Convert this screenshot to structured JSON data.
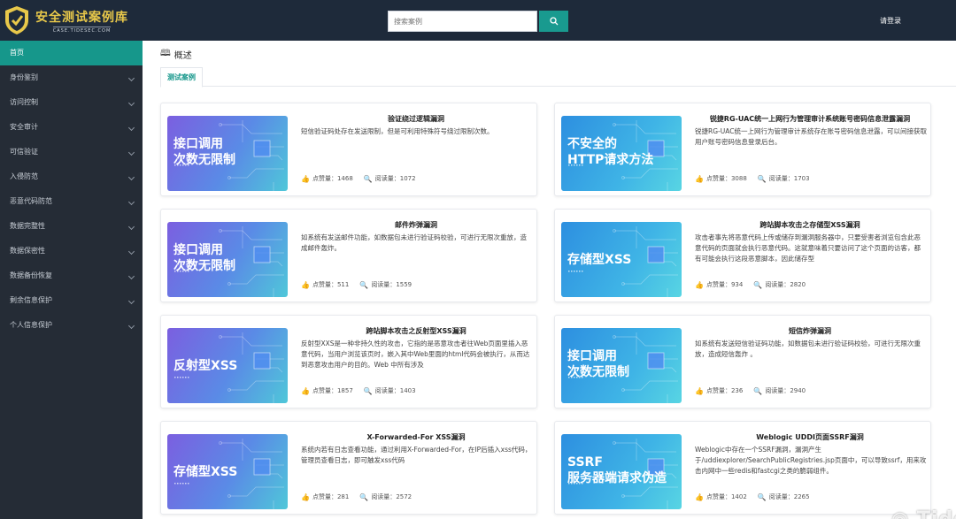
{
  "logo": {
    "title": "安全测试案例库",
    "subtitle": "CASE.TIDESEC.COM"
  },
  "search": {
    "placeholder": "搜索案例"
  },
  "login_label": "请登录",
  "sidebar": {
    "items": [
      {
        "label": "首页",
        "active": true,
        "arrow": false
      },
      {
        "label": "身份鉴别",
        "arrow": true
      },
      {
        "label": "访问控制",
        "arrow": true
      },
      {
        "label": "安全审计",
        "arrow": true
      },
      {
        "label": "可信验证",
        "arrow": true
      },
      {
        "label": "入侵防范",
        "arrow": true
      },
      {
        "label": "恶意代码防范",
        "arrow": true
      },
      {
        "label": "数据完整性",
        "arrow": true
      },
      {
        "label": "数据保密性",
        "arrow": true
      },
      {
        "label": "数据备份恢复",
        "arrow": true
      },
      {
        "label": "剩余信息保护",
        "arrow": true
      },
      {
        "label": "个人信息保护",
        "arrow": true
      }
    ]
  },
  "page_title": "概述",
  "tab_label": "测试案例",
  "stat_labels": {
    "likes": "点赞量：",
    "reads": "阅读量："
  },
  "cards": [
    {
      "title": "验证绕过逻辑漏洞",
      "desc": "短信验证码处存在发送限制，但是可利用特殊符号绕过限制次数。",
      "likes": "1468",
      "reads": "1072",
      "thumb_lines": [
        "接口调用",
        "次数无限制"
      ],
      "theme": "purple"
    },
    {
      "title": "锐捷RG-UAC统一上网行为管理审计系统账号密码信息泄露漏洞",
      "desc": "锐捷RG-UAC统一上网行为管理审计系统存在账号密码信息泄露，可以间接获取用户账号密码信息登录后台。",
      "likes": "3088",
      "reads": "1703",
      "thumb_lines": [
        "不安全的",
        "HTTP请求方法"
      ],
      "theme": "blue"
    },
    {
      "title": "邮件炸弹漏洞",
      "desc": "如系统有发送邮件功能，如数据包未进行验证码校验，可进行无限次重放，造成邮件轰炸。",
      "likes": "511",
      "reads": "1559",
      "thumb_lines": [
        "接口调用",
        "次数无限制"
      ],
      "theme": "purple"
    },
    {
      "title": "跨站脚本攻击之存储型XSS漏洞",
      "desc": "攻击者事先将恶意代码上传或储存到漏洞服务器中，只要受害者浏览包含此恶意代码的页面就会执行恶意代码。这就意味着只要访问了这个页面的访客，都有可能会执行这段恶意脚本，因此储存型",
      "likes": "934",
      "reads": "2820",
      "thumb_lines": [
        "存储型XSS"
      ],
      "theme": "blue"
    },
    {
      "title": "跨站脚本攻击之反射型XSS漏洞",
      "desc": "反射型XXS是一种非持久性的攻击，它指的是恶意攻击者往Web页面里插入恶意代码，当用户浏览该页时，嵌入其中Web里面的html代码会被执行，从而达到恶意攻击用户的目的。Web 中所有涉及",
      "likes": "1857",
      "reads": "1403",
      "thumb_lines": [
        "反射型XSS"
      ],
      "theme": "purple"
    },
    {
      "title": "短信炸弹漏洞",
      "desc": "如系统有发送短信验证码功能，如数据包未进行验证码校验，可进行无限次重放，造成短信轰炸 。",
      "likes": "236",
      "reads": "2940",
      "thumb_lines": [
        "接口调用",
        "次数无限制"
      ],
      "theme": "blue"
    },
    {
      "title": "X-Forwarded-For XSS漏洞",
      "desc": "系统内若有日志查看功能，通过利用X-Forwarded-For，在IP后插入xss代码，管理员查看日志，即可触发xss代码",
      "likes": "281",
      "reads": "2572",
      "thumb_lines": [
        "存储型XSS"
      ],
      "theme": "purple"
    },
    {
      "title": "Weblogic UDDI页面SSRF漏洞",
      "desc": "Weblogic中存在一个SSRF漏洞，漏洞产生于/uddiexplorer/SearchPublicRegistries.jsp页面中，可以导致ssrf，用来攻击内网中一些redis和fastcgi之类的脆弱组件。",
      "likes": "1402",
      "reads": "2265",
      "thumb_lines": [
        "SSRF",
        "服务器端请求伪造"
      ],
      "theme": "blue"
    }
  ],
  "watermark": "Tide安全团队"
}
